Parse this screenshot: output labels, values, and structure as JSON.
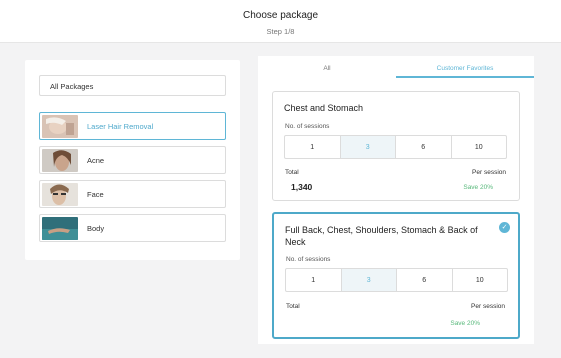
{
  "header": {
    "title": "Choose package",
    "step": "Step 1/8"
  },
  "filter": {
    "selected": "All Packages"
  },
  "categories": [
    {
      "label": "Laser Hair Removal",
      "active": true
    },
    {
      "label": "Acne",
      "active": false
    },
    {
      "label": "Face",
      "active": false
    },
    {
      "label": "Body",
      "active": false
    }
  ],
  "tabs": {
    "all": "All",
    "favorites": "Customer Favorites",
    "active": "favorites"
  },
  "cards": [
    {
      "title": "Chest and Stomach",
      "sessions_label": "No. of sessions",
      "options": [
        "1",
        "3",
        "6",
        "10"
      ],
      "selected_option": "3",
      "total_label": "Total",
      "total": "1,340",
      "per_session_label": "Per session",
      "save": "Save 20%",
      "selected": false
    },
    {
      "title": "Full Back, Chest, Shoulders, Stomach & Back of Neck",
      "sessions_label": "No. of sessions",
      "options": [
        "1",
        "3",
        "6",
        "10"
      ],
      "selected_option": "3",
      "total_label": "Total",
      "total": "",
      "per_session_label": "Per session",
      "save": "Save 20%",
      "selected": true
    }
  ],
  "colors": {
    "accent": "#5fb6d6",
    "save_green": "#57b87a",
    "background": "#f3f3f4"
  }
}
